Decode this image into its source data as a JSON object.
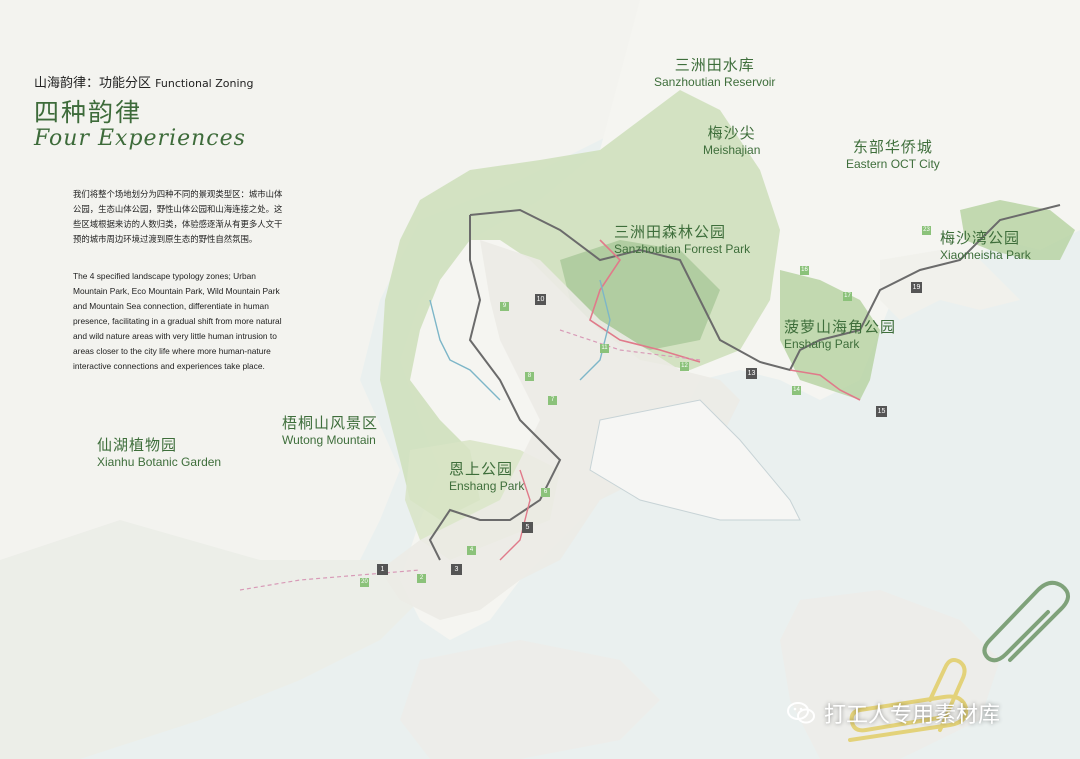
{
  "colors": {
    "sea": "#e9efee",
    "land": "#f4f4f0",
    "park_green": "#c9dcb8",
    "park_green_dark": "#a9c898",
    "trail_pink": "#e07a8a",
    "river_blue": "#7db6c8",
    "text_green": "#3e6e3b",
    "clip_green": "#7fa27a",
    "clip_yellow": "#e3d27a"
  },
  "header": {
    "kicker_zh": "山海韵律：功能分区",
    "kicker_en": "Functional Zoning",
    "title_zh": "四种韵律",
    "title_en": "Four Experiences"
  },
  "description": {
    "zh": "我们将整个场地划分为四种不同的景观类型区：城市山体公园，生态山体公园，野性山体公园和山海连接之处。这些区域根据来访的人数归类，体验感逐渐从有更多人文干预的城市周边环境过渡到原生态的野性自然氛围。",
    "en": "The 4 specified landscape typology zones; Urban Mountain Park, Eco Mountain Park, Wild Mountain Park and Mountain Sea connection, differentiate in human presence, facilitating in a gradual shift from more natural and wild nature areas with very little human intrusion to areas closer to the city life where more human-nature interactive connections and experiences take place."
  },
  "places": [
    {
      "id": "sanzhoutian-reservoir",
      "zh": "三洲田水库",
      "en": "Sanzhoutian Reservoir"
    },
    {
      "id": "meishajian",
      "zh": "梅沙尖",
      "en": "Meishajian"
    },
    {
      "id": "eastern-oct-city",
      "zh": "东部华侨城",
      "en": "Eastern OCT City"
    },
    {
      "id": "sanzhoutian-forest-park",
      "zh": "三洲田森林公园",
      "en": "Sanzhoutian Forrest Park"
    },
    {
      "id": "xiaomeisha-park",
      "zh": "梅沙湾公园",
      "en": "Xiaomeisha  Park"
    },
    {
      "id": "enshang-park-sea",
      "zh": "菠萝山海角公园",
      "en": "Enshang Park"
    },
    {
      "id": "wutong-mountain",
      "zh": "梧桐山风景区",
      "en": "Wutong Mountain"
    },
    {
      "id": "xianhu-botanic-garden",
      "zh": "仙湖植物园",
      "en": "Xianhu Botanic Garden"
    },
    {
      "id": "enshang-park",
      "zh": "恩上公园",
      "en": "Enshang Park"
    }
  ],
  "nodes": {
    "dark": [
      "1",
      "3",
      "5",
      "10",
      "13",
      "15",
      "19"
    ],
    "green": [
      "2",
      "4",
      "6",
      "7",
      "8",
      "9",
      "11",
      "12",
      "14",
      "16",
      "17",
      "20",
      "23"
    ]
  },
  "watermark": {
    "text": "打工人专用素材库",
    "icon": "wechat-icon"
  }
}
